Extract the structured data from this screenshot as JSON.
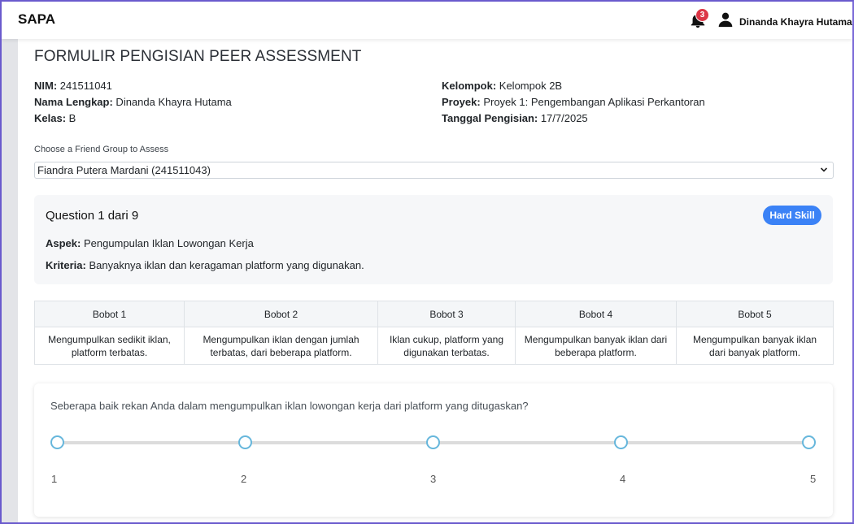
{
  "navbar": {
    "brand": "SAPA",
    "notification_count": "3",
    "username": "Dinanda Khayra Hutama"
  },
  "page": {
    "title": "FORMULIR PENGISIAN PEER ASSESSMENT"
  },
  "info": {
    "nim_label": "NIM:",
    "nim": " 241511041",
    "nama_label": "Nama Lengkap:",
    "nama": " Dinanda Khayra Hutama",
    "kelas_label": "Kelas:",
    "kelas": " B",
    "kelompok_label": "Kelompok:",
    "kelompok": " Kelompok 2B",
    "proyek_label": "Proyek:",
    "proyek": " Proyek 1: Pengembangan Aplikasi Perkantoran",
    "tanggal_label": "Tanggal Pengisian:",
    "tanggal": " 17/7/2025"
  },
  "select": {
    "label": "Choose a Friend Group to Assess",
    "value": "Fiandra Putera Mardani (241511043)"
  },
  "question": {
    "title": "Question 1 dari 9",
    "skill": "Hard Skill",
    "aspek_label": "Aspek:",
    "aspek": " Pengumpulan Iklan Lowongan Kerja",
    "kriteria_label": "Kriteria:",
    "kriteria": " Banyaknya iklan dan keragaman platform yang digunakan."
  },
  "rubric": {
    "headers": [
      "Bobot 1",
      "Bobot 2",
      "Bobot 3",
      "Bobot 4",
      "Bobot 5"
    ],
    "cells": [
      "Mengumpulkan sedikit iklan, platform terbatas.",
      "Mengumpulkan iklan dengan jumlah terbatas, dari beberapa platform.",
      "Iklan cukup, platform yang digunakan terbatas.",
      "Mengumpulkan banyak iklan dari beberapa platform.",
      "Mengumpulkan banyak iklan dari banyak platform."
    ]
  },
  "scale": {
    "question": "Seberapa baik rekan Anda dalam mengumpulkan iklan lowongan kerja dari platform yang ditugaskan?",
    "labels": [
      "1",
      "2",
      "3",
      "4",
      "5"
    ]
  },
  "colors": {
    "accent": "#3b82f6",
    "badge": "#dc3545",
    "dot_border": "#67b7dc"
  }
}
